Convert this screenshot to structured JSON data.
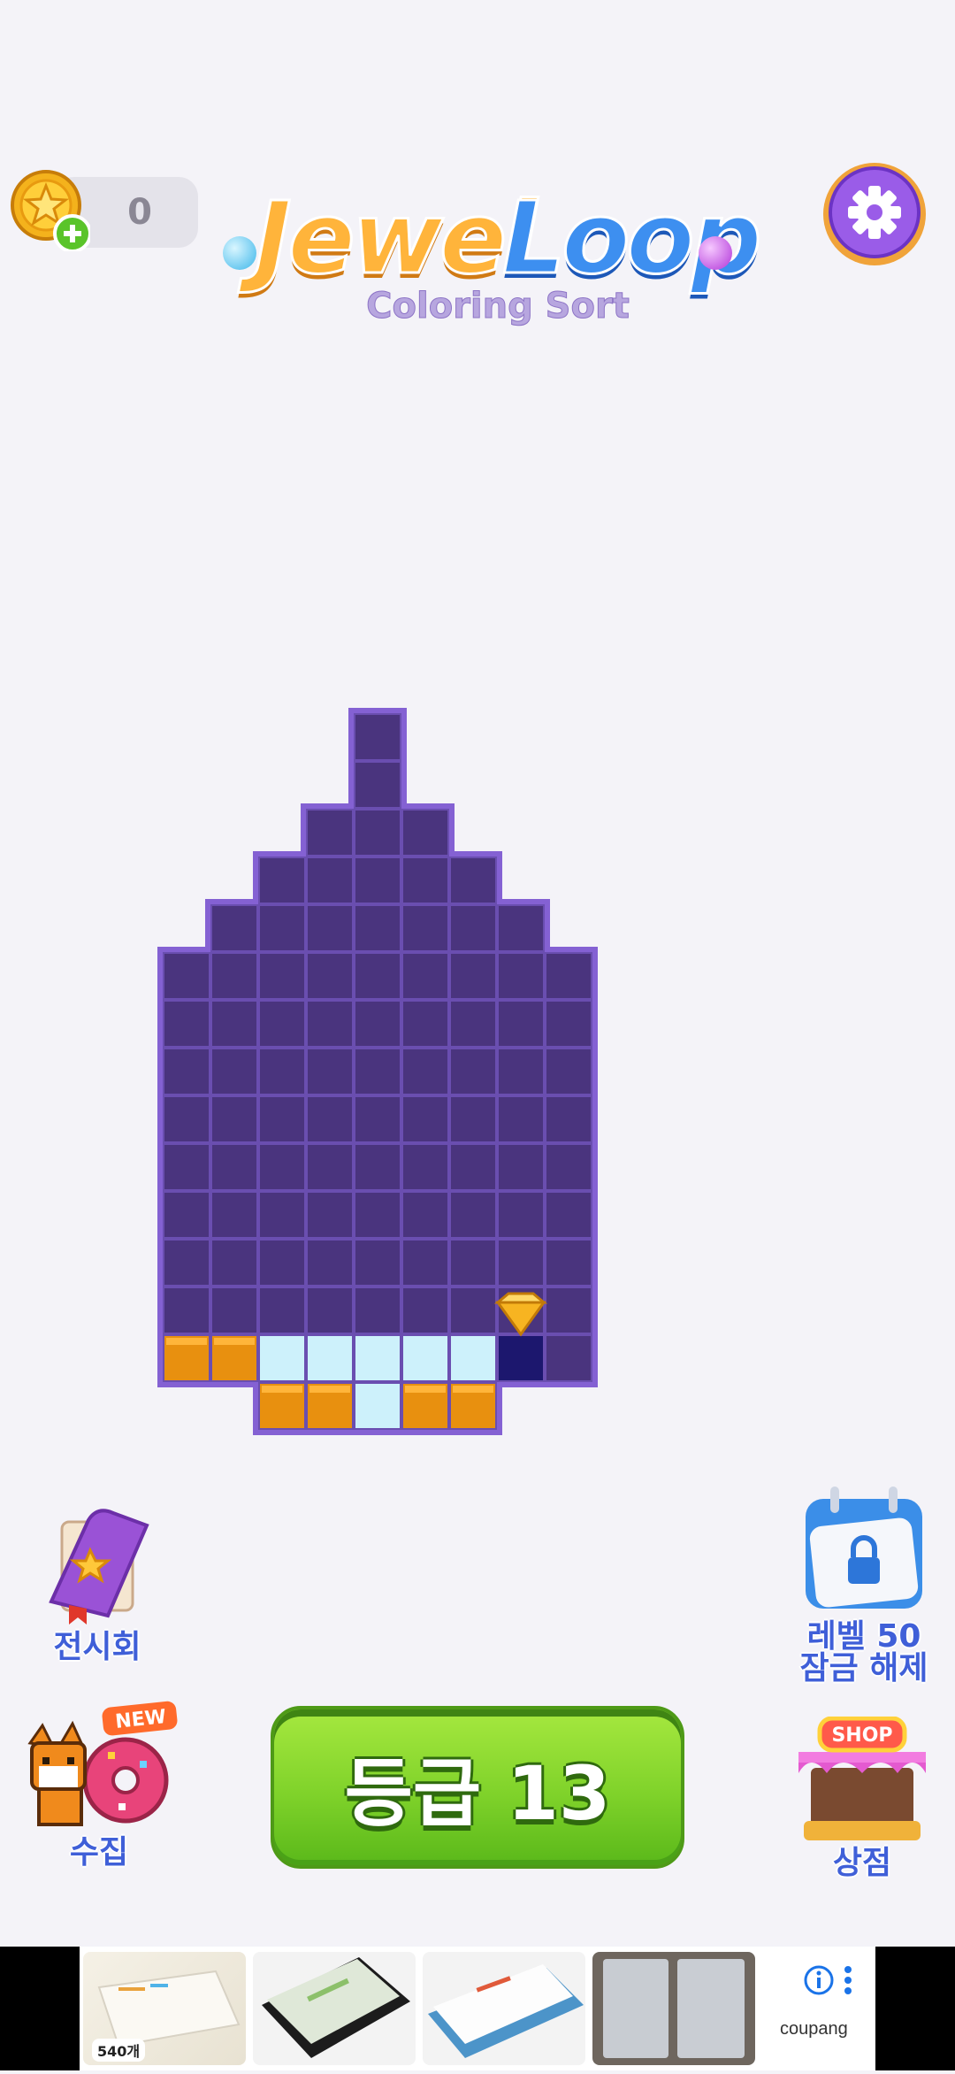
{
  "app": {
    "logo_text_1": "Jewel",
    "logo_text_2": "Loop",
    "logo_subtitle": "Coloring Sort"
  },
  "header": {
    "coin_count": "0",
    "coin_icon": "star-coin-icon",
    "add_icon": "plus-icon",
    "settings_icon": "gear-icon"
  },
  "colors": {
    "board_empty": "#4a347e",
    "board_border": "#8461d3",
    "jewel_orange": "#e8900f",
    "jewel_lightblue": "#cdf1fb",
    "jewel_navy": "#1c176e",
    "play_green": "#7fd22a",
    "label_blue": "#3f5fd8"
  },
  "board": {
    "rows": [
      "....#....",
      "....#....",
      "...###...",
      "..#####..",
      ".#######.",
      "#########",
      "#########",
      "#########",
      "#########",
      "#########",
      "#########",
      "#########",
      "#########",
      "#########"
    ],
    "filled_bottom": [
      {
        "row": 13,
        "cols": "OOBBBBBN#"
      },
      {
        "row": 14,
        "cols": "OOBOO"
      }
    ],
    "marker_icon": "gold-gem-icon"
  },
  "side_buttons": {
    "exhibition": {
      "label": "전시회",
      "icon": "book-icon"
    },
    "locked": {
      "label_line1": "레벨 50",
      "label_line2": "잠금 해제",
      "icon": "calendar-lock-icon"
    },
    "collection": {
      "label": "수집",
      "badge": "NEW",
      "icon": "fox-donut-icon"
    },
    "shop": {
      "label": "상점",
      "sign": "SHOP",
      "icon": "shop-stall-icon"
    }
  },
  "play": {
    "label": "등급 13"
  },
  "ad": {
    "count_badge": "540개",
    "brand": "coupang",
    "info_icon": "info-icon",
    "more_icon": "more-vertical-icon"
  }
}
